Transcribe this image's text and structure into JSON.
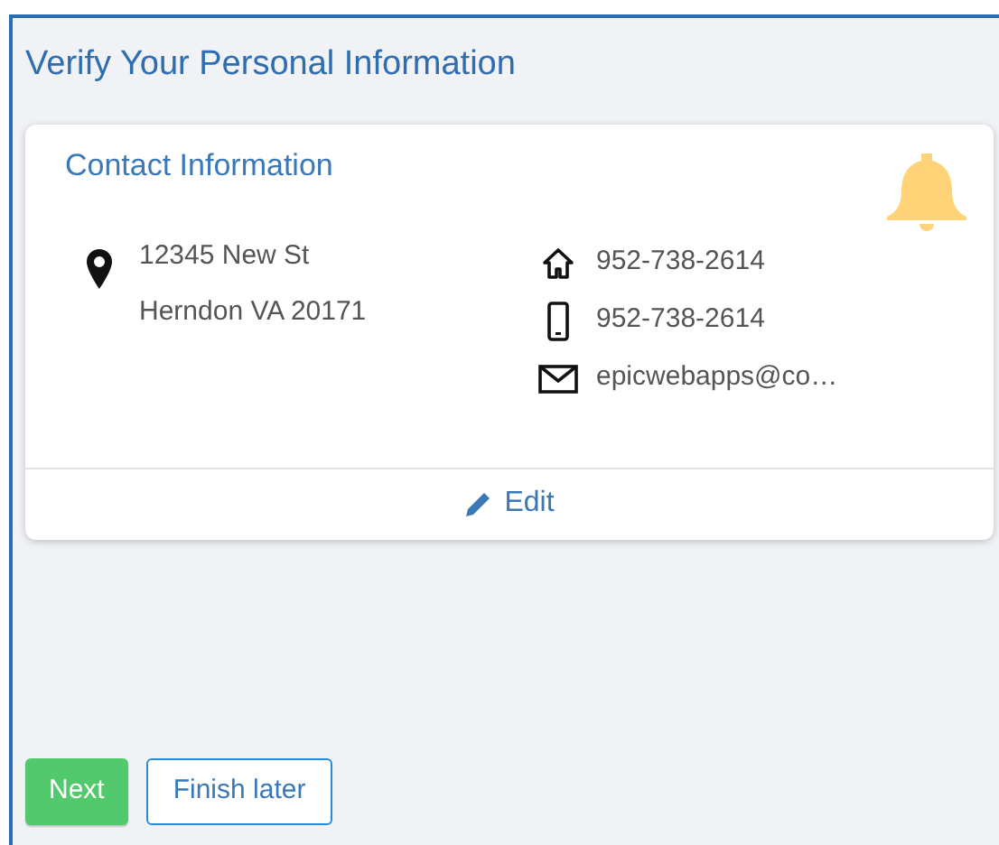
{
  "page": {
    "title": "Verify Your Personal Information"
  },
  "card": {
    "title": "Contact Information",
    "address": [
      "12345 New St",
      "Herndon VA 20171"
    ],
    "contacts": [
      {
        "kind": "home",
        "text": "952-738-2614"
      },
      {
        "kind": "mobile",
        "text": "952-738-2614"
      },
      {
        "kind": "email",
        "text": "epicwebapps@co…"
      }
    ],
    "edit": "Edit"
  },
  "buttons": [
    {
      "kind": "primary",
      "label": "Next"
    },
    {
      "kind": "secondary",
      "label": "Finish later"
    }
  ]
}
